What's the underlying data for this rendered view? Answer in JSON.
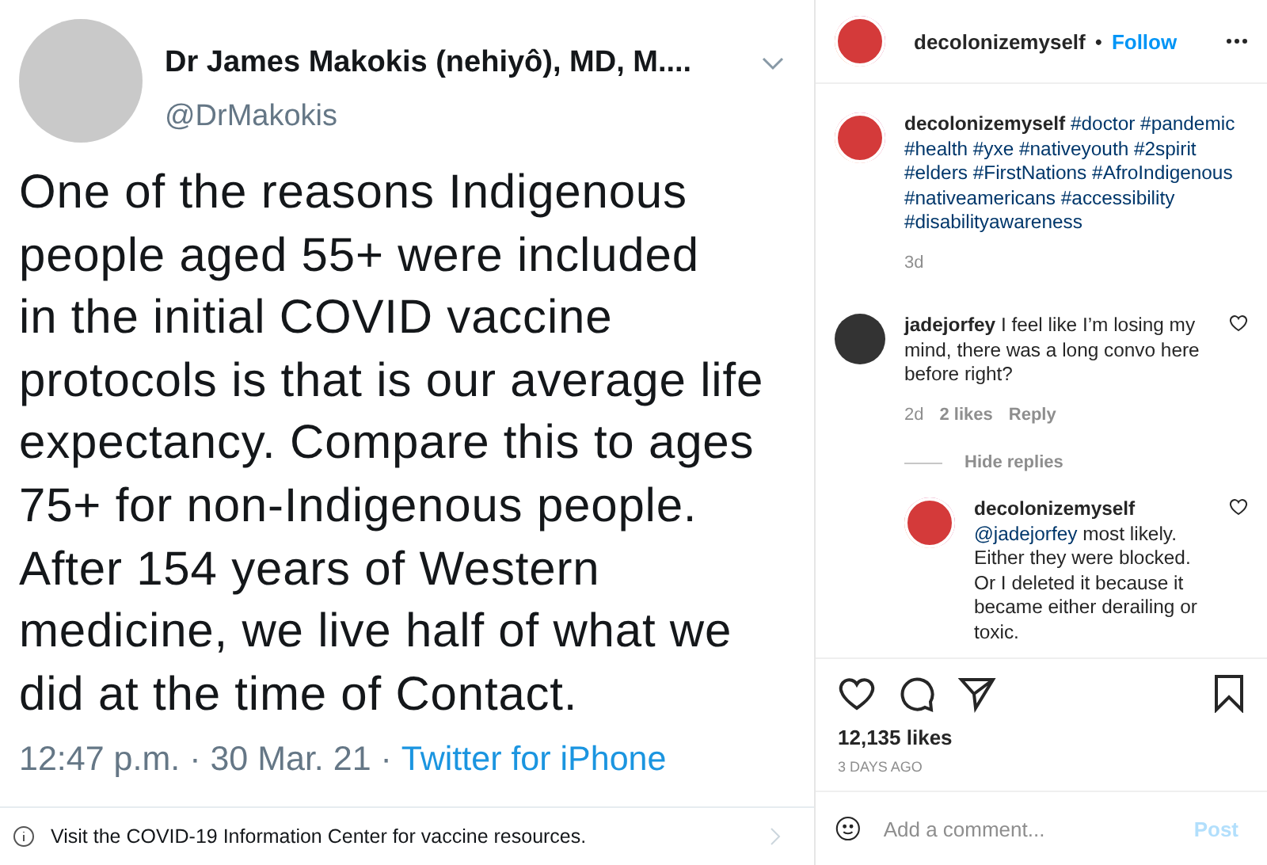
{
  "tweet": {
    "name": "Dr James Makokis (nehiyô), MD, M....",
    "handle": "@DrMakokis",
    "text_lines": [
      "One of the reasons Indigenous",
      "people aged 55+ were included",
      "in the initial COVID vaccine",
      "protocols is that is our average life",
      "expectancy. Compare this to ages",
      "75+ for non-Indigenous people.",
      "After 154 years of Western",
      "medicine, we live half of what we",
      "did at the time of Contact."
    ],
    "time": "12:47 p.m. · 30 Mar. 21 ·",
    "source": "Twitter for iPhone",
    "notice": "Visit the COVID-19 Information Center for vaccine resources."
  },
  "post": {
    "username": "decolonizemyself",
    "separator": "•",
    "follow": "Follow",
    "caption": {
      "username": "decolonizemyself",
      "text": "#doctor #pandemic #health #yxe #nativeyouth #2spirit #elders #FirstNations #AfroIndigenous #nativeamericans #accessibility #disabilityawareness",
      "age": "3d"
    },
    "comment": {
      "username": "jadejorfey",
      "text": "I feel like I’m losing my mind, there was a long convo here before right?",
      "age": "2d",
      "likes": "2 likes",
      "reply": "Reply"
    },
    "hide_replies": "Hide replies",
    "reply": {
      "username": "decolonizemyself",
      "mention": "@jadejorfey",
      "text": "most likely. Either they were blocked. Or I deleted it because it became either derailing or toxic."
    },
    "likes": "12,135 likes",
    "date": "3 DAYS AGO",
    "comment_placeholder": "Add a comment...",
    "post_button": "Post"
  }
}
